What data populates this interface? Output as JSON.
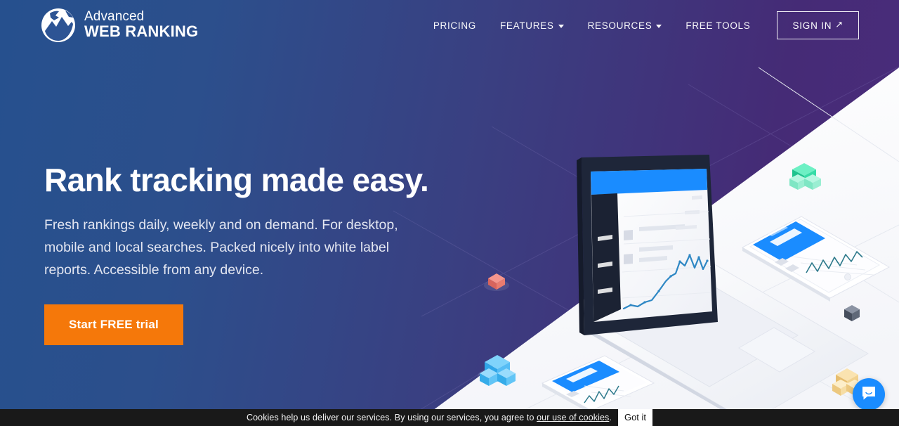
{
  "brand": {
    "logo_line1": "Advanced",
    "logo_line2": "WEB RANKING",
    "logo_icon": "globe-mountain-icon"
  },
  "nav": {
    "items": [
      {
        "label": "PRICING",
        "has_caret": false
      },
      {
        "label": "FEATURES",
        "has_caret": true
      },
      {
        "label": "RESOURCES",
        "has_caret": true
      },
      {
        "label": "FREE TOOLS",
        "has_caret": false
      }
    ],
    "signin_label": "SIGN IN",
    "signin_arrow": "↗"
  },
  "hero": {
    "headline": "Rank tracking made easy.",
    "subhead": "Fresh rankings daily, weekly and on demand. For desktop, mobile and local searches. Packed nicely into white label reports. Accessible from any device.",
    "cta_label": "Start FREE trial"
  },
  "illustration": {
    "description": "isometric-devices-scene",
    "devices": [
      "laptop",
      "tablet",
      "smartphone"
    ],
    "cubes": [
      {
        "name": "red-cube",
        "color": "#f0746a"
      },
      {
        "name": "blue-cube",
        "color": "#3fb4f2"
      },
      {
        "name": "green-cube",
        "color": "#2fd7a2"
      },
      {
        "name": "gray-cube",
        "color": "#5c6370"
      },
      {
        "name": "yellow-cube",
        "color": "#f3cf8a"
      }
    ]
  },
  "chat": {
    "icon": "chat-bubble-icon",
    "color": "#1a8cff"
  },
  "cookies": {
    "text_before": "Cookies help us deliver our services. By using our services, you agree to ",
    "link_label": "our use of cookies",
    "text_after": ".",
    "button_label": "Got it"
  },
  "colors": {
    "gradient_left": "#26508e",
    "gradient_right": "#4b2c7c",
    "cta_orange": "#f5780a",
    "accent_blue": "#1a8cff",
    "cookie_bar": "#191919"
  }
}
